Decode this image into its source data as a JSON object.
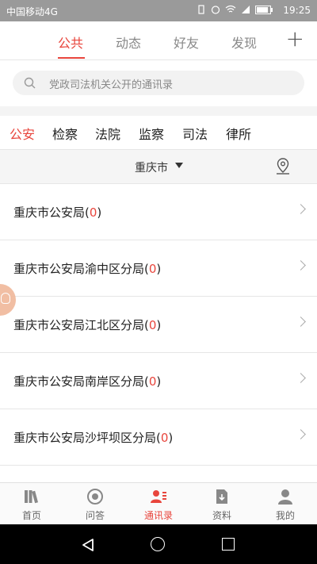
{
  "status": {
    "carrier": "中国移动4G",
    "time": "19:25"
  },
  "topnav": {
    "tabs": [
      {
        "label": "公共"
      },
      {
        "label": "动态"
      },
      {
        "label": "好友"
      },
      {
        "label": "发现"
      }
    ],
    "active_tab": "公共"
  },
  "search": {
    "placeholder": "党政司法机关公开的通讯录"
  },
  "categories": {
    "items": [
      "公安",
      "检察",
      "法院",
      "监察",
      "司法",
      "律所"
    ],
    "active": "公安"
  },
  "city": {
    "name": "重庆市"
  },
  "list": [
    {
      "name": "重庆市公安局",
      "count": "0"
    },
    {
      "name": "重庆市公安局渝中区分局",
      "count": "0"
    },
    {
      "name": "重庆市公安局江北区分局",
      "count": "0"
    },
    {
      "name": "重庆市公安局南岸区分局",
      "count": "0"
    },
    {
      "name": "重庆市公安局沙坪坝区分局",
      "count": "0"
    }
  ],
  "bottomnav": {
    "items": [
      {
        "label": "首页",
        "icon": "books-icon"
      },
      {
        "label": "问答",
        "icon": "chat-icon"
      },
      {
        "label": "通讯录",
        "icon": "contacts-icon"
      },
      {
        "label": "资料",
        "icon": "document-download-icon"
      },
      {
        "label": "我的",
        "icon": "user-icon"
      }
    ],
    "active": "通讯录"
  },
  "colors": {
    "accent": "#e8453c",
    "statusbar": "#9a9a9a"
  }
}
